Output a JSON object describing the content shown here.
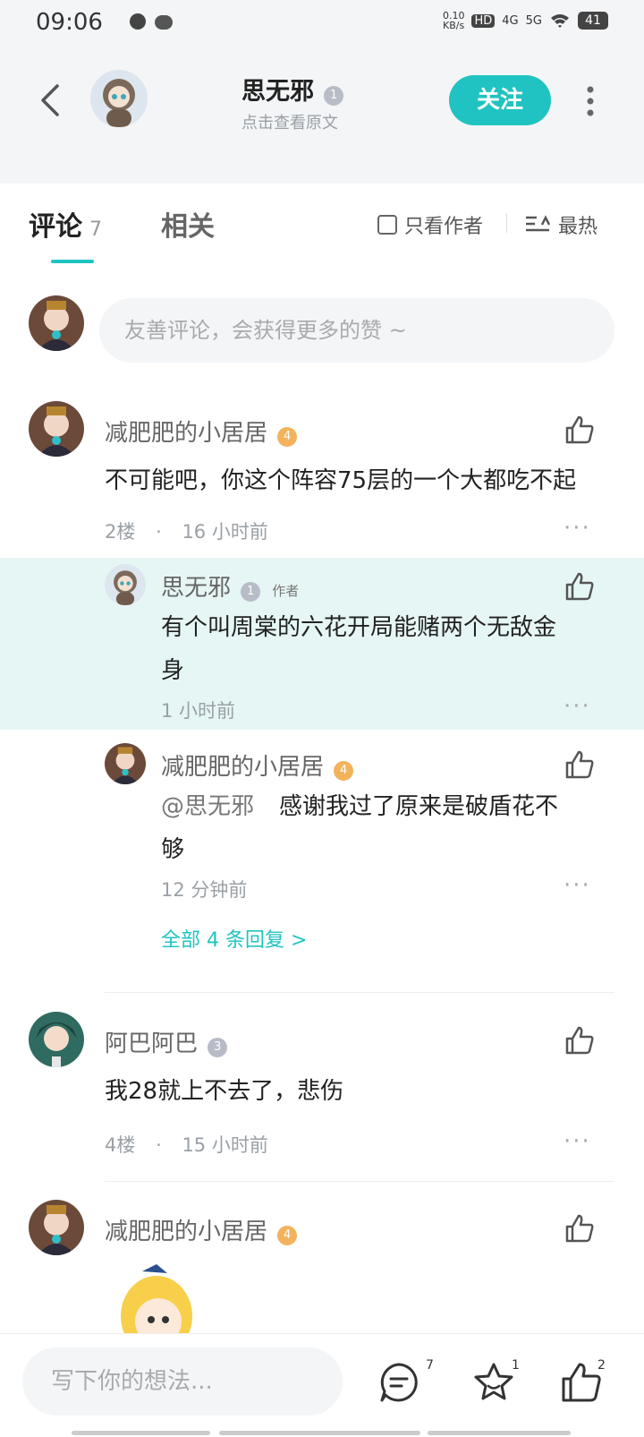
{
  "status_bar": {
    "time": "09:06",
    "net_speed_top": "0.10",
    "net_speed_bottom": "KB/s",
    "signal_labels": [
      "HD",
      "4G",
      "5G"
    ],
    "battery": "41"
  },
  "header": {
    "author_name": "思无邪",
    "author_level": "1",
    "subtitle": "点击查看原文",
    "follow_label": "关注"
  },
  "tabs": {
    "comments_label": "评论",
    "comments_count": "7",
    "related_label": "相关",
    "author_only_label": "只看作者",
    "sort_label": "最热"
  },
  "comment_input": {
    "placeholder": "友善评论，会获得更多的赞 ~"
  },
  "comments": [
    {
      "name": "减肥肥的小居居",
      "level": "4",
      "text": "不可能吧，你这个阵容75层的一个大都吃不起",
      "floor": "2楼",
      "time": "16  小时前",
      "replies": [
        {
          "name": "思无邪",
          "level": "1",
          "tag": "作者",
          "text_line1": "有个叫周棠的六花开局能赌两个无敌金",
          "text_line2": "身",
          "time": "1  小时前"
        },
        {
          "name": "减肥肥的小居居",
          "level": "4",
          "mention": "@思无邪",
          "text_line1": "感谢我过了原来是破盾花不",
          "text_line2": "够",
          "time": "12  分钟前"
        }
      ],
      "more_replies": "全部  4  条回复  >"
    },
    {
      "name": "阿巴阿巴",
      "level": "3",
      "text": "我28就上不去了，悲伤",
      "floor": "4楼",
      "time": "15  小时前"
    },
    {
      "name": "减肥肥的小居居",
      "level": "4"
    }
  ],
  "bottom_bar": {
    "placeholder": "写下你的想法...",
    "comment_count": "7",
    "favorite_count": "1",
    "like_count": "2"
  },
  "colors": {
    "accent": "#20c3c1",
    "highlight_bg": "#e6f6f5"
  }
}
